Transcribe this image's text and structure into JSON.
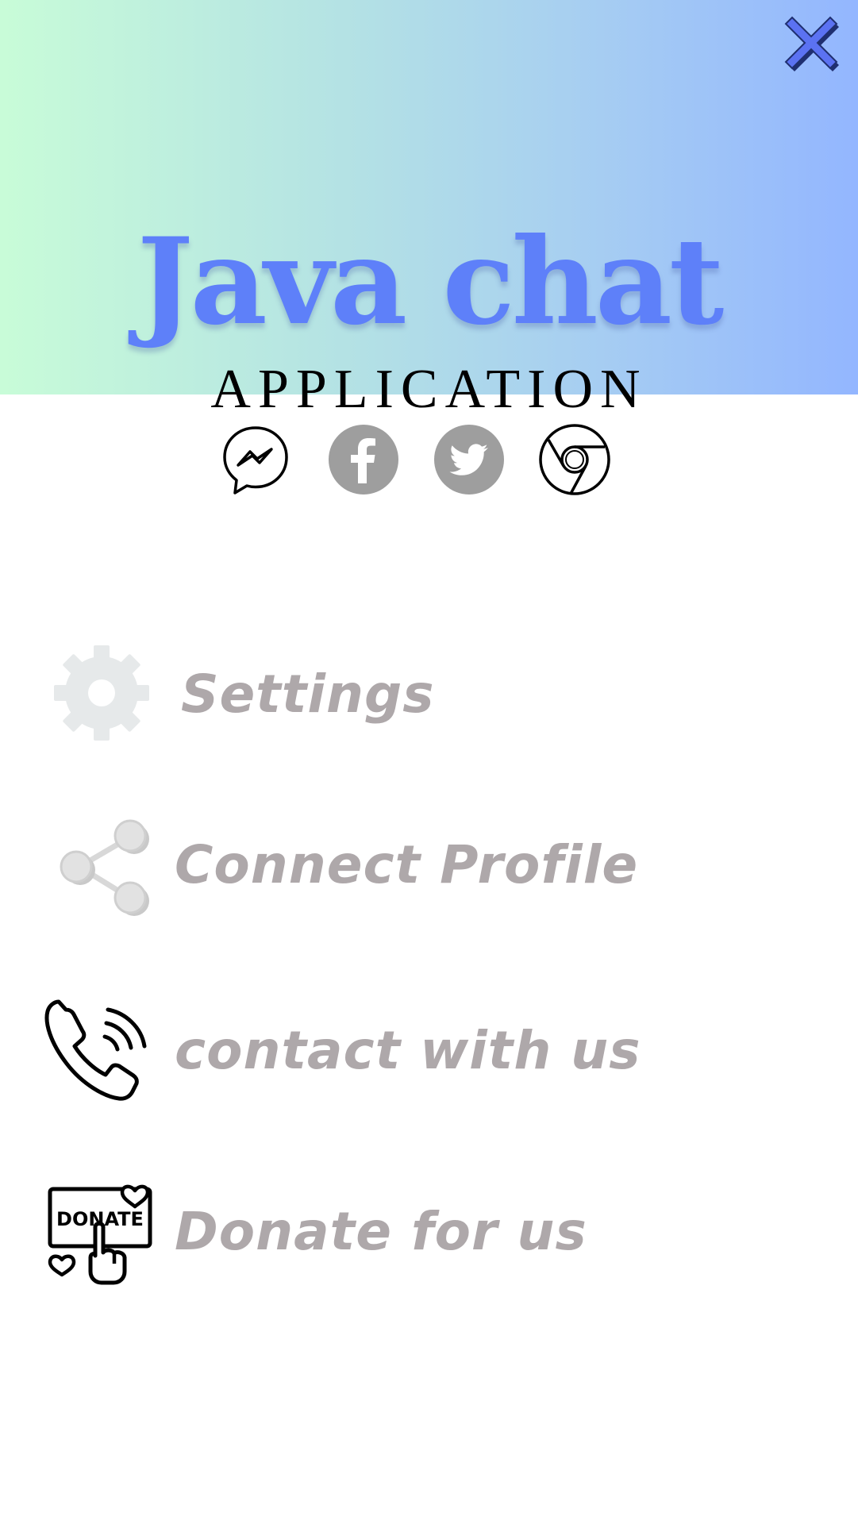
{
  "header": {
    "title": "Java chat",
    "subtitle": "APPLICATION",
    "accent_color": "#5e80f9",
    "gradient": [
      "#c8fcd8",
      "#93b6ff"
    ]
  },
  "close_icon": "close-icon",
  "social_icons": [
    {
      "name": "messenger-icon"
    },
    {
      "name": "facebook-icon"
    },
    {
      "name": "twitter-icon"
    },
    {
      "name": "chrome-icon"
    }
  ],
  "menu": {
    "items": [
      {
        "icon": "gear-icon",
        "label": "Settings"
      },
      {
        "icon": "share-icon",
        "label": "Connect Profile"
      },
      {
        "icon": "phone-icon",
        "label": "contact with us"
      },
      {
        "icon": "donate-icon",
        "label": "Donate for us"
      }
    ],
    "label_color": "#aea8aa"
  }
}
